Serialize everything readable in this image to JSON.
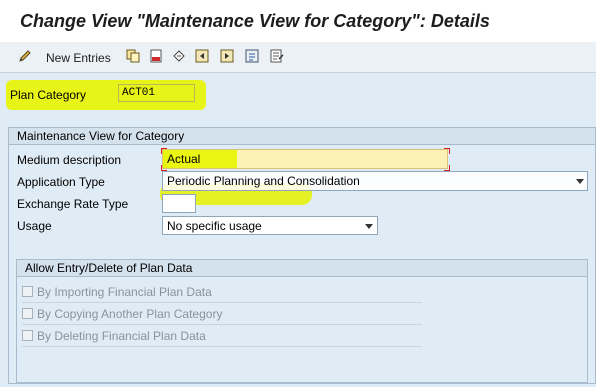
{
  "window": {
    "title": "Change View \"Maintenance View for Category\": Details"
  },
  "toolbar": {
    "new_entries_label": "New Entries",
    "icons": [
      "edit-pencil-icon",
      "copy-icon",
      "delete-icon",
      "undo-icon",
      "first-page-icon",
      "previous-page-icon",
      "next-page-icon",
      "save-variant-icon"
    ]
  },
  "header_field": {
    "label": "Plan Category",
    "value": "ACT01"
  },
  "group": {
    "title": "Maintenance View for Category",
    "fields": [
      {
        "label": "Medium description",
        "value": "Actual"
      },
      {
        "label": "Application Type",
        "value": "Periodic Planning and Consolidation"
      },
      {
        "label": "Exchange Rate Type",
        "value": ""
      },
      {
        "label": "Usage",
        "value": "No specific usage"
      }
    ]
  },
  "subgroup": {
    "title": "Allow Entry/Delete of Plan Data",
    "checkboxes": [
      {
        "label": "By Importing Financial Plan Data",
        "checked": false
      },
      {
        "label": "By Copying Another Plan Category",
        "checked": false
      },
      {
        "label": "By Deleting Financial Plan Data",
        "checked": false
      }
    ]
  },
  "colors": {
    "highlight": "#e6f200",
    "background": "#dfebf5",
    "required_marker": "#d42020"
  }
}
